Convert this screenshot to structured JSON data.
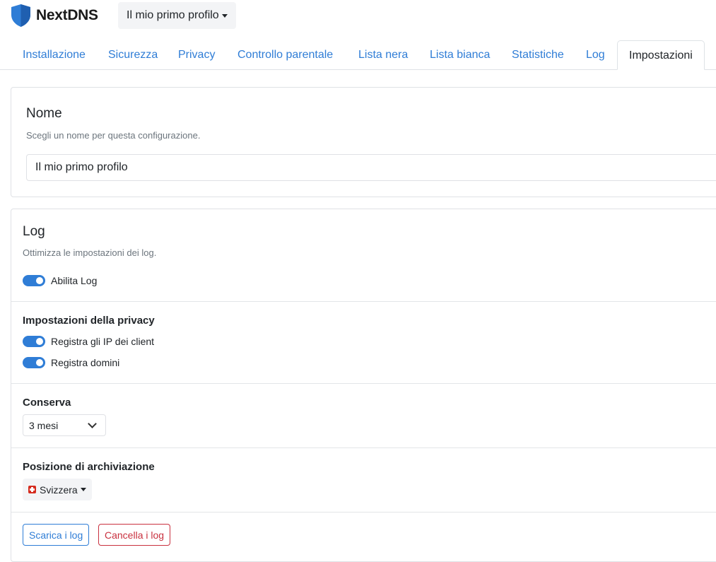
{
  "brand": {
    "name": "NextDNS",
    "logo_icon": "shield-icon",
    "color": "#2f7dd6"
  },
  "profile_selector": {
    "label": "Il mio primo profilo"
  },
  "tabs": [
    {
      "label": "Installazione",
      "active": false
    },
    {
      "label": "Sicurezza",
      "active": false
    },
    {
      "label": "Privacy",
      "active": false
    },
    {
      "label": "Controllo parentale",
      "active": false
    },
    {
      "label": "Lista nera",
      "active": false
    },
    {
      "label": "Lista bianca",
      "active": false
    },
    {
      "label": "Statistiche",
      "active": false
    },
    {
      "label": "Log",
      "active": false
    },
    {
      "label": "Impostazioni",
      "active": true
    }
  ],
  "name_card": {
    "title": "Nome",
    "description": "Scegli un nome per questa configurazione.",
    "input_value": "Il mio primo profilo"
  },
  "log_card": {
    "title": "Log",
    "description": "Ottimizza le impostazioni dei log.",
    "enable_logs": {
      "label": "Abilita Log",
      "on": true
    },
    "privacy": {
      "title": "Impostazioni della privacy",
      "log_client_ips": {
        "label": "Registra gli IP dei client",
        "on": true
      },
      "log_domains": {
        "label": "Registra domini",
        "on": true
      }
    },
    "retention": {
      "title": "Conserva",
      "selected": "3 mesi"
    },
    "storage_location": {
      "title": "Posizione di archiviazione",
      "selected": "Svizzera",
      "flag_icon": "swiss-flag-icon"
    },
    "actions": {
      "download_label": "Scarica i log",
      "clear_label": "Cancella i log"
    }
  },
  "colors": {
    "link": "#2f7dd6",
    "danger": "#c9313f",
    "switch_on": "#2f7dd6"
  }
}
